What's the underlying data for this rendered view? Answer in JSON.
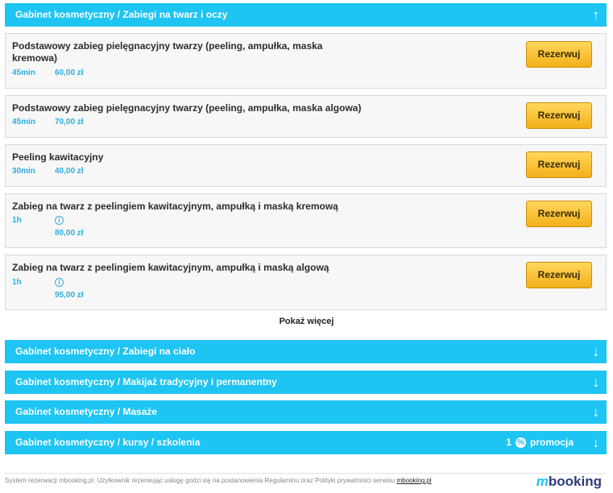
{
  "categories": {
    "face": {
      "title": "Gabinet kosmetyczny / Zabiegi na twarz i oczy",
      "arrow": "↑"
    },
    "body": {
      "title": "Gabinet kosmetyczny / Zabiegi na ciało",
      "arrow": "↓"
    },
    "makeup": {
      "title": "Gabinet kosmetyczny / Makijaż tradycyjny i permanentny",
      "arrow": "↓"
    },
    "massage": {
      "title": "Gabinet kosmetyczny / Masaże",
      "arrow": "↓"
    },
    "courses": {
      "title": "Gabinet kosmetyczny / kursy / szkolenia",
      "arrow": "↓",
      "promo_count": "1",
      "promo_label": "promocja"
    }
  },
  "services": [
    {
      "name": "Podstawowy zabieg pielęgnacyjny twarzy (peeling, ampułka, maska kremowa)",
      "duration": "45min",
      "price": "60,00 zł",
      "button": "Rezerwuj"
    },
    {
      "name": "Podstawowy zabieg pielęgnacyjny twarzy (peeling, ampułka, maska algowa)",
      "duration": "45min",
      "price": "70,00 zł",
      "button": "Rezerwuj"
    },
    {
      "name": "Peeling kawitacyjny",
      "duration": "30min",
      "price": "40,00 zł",
      "button": "Rezerwuj"
    },
    {
      "name": "Zabieg na twarz z peelingiem kawitacyjnym, ampułką i maską kremową",
      "duration": "1h",
      "price": "80,00 zł",
      "button": "Rezerwuj",
      "info_icon": "info-icon"
    },
    {
      "name": "Zabieg na twarz z peelingiem kawitacyjnym, ampułką i maską algową",
      "duration": "1h",
      "price": "95,00 zł",
      "button": "Rezerwuj",
      "info_icon": "info-icon"
    }
  ],
  "show_more": "Pokaż więcej",
  "footer": {
    "text": "System rezerwacji mbooking.pl. Użytkownik rezerwując usługę godzi się na postanowienia Regulaminu oraz Polityki prywatności serwisu",
    "link": "mbooking.pl",
    "logo_m": "m",
    "logo_rest": "booking"
  },
  "colors": {
    "accent": "#1ec4f2",
    "button": "#f7c332",
    "meta": "#2eaee0"
  }
}
